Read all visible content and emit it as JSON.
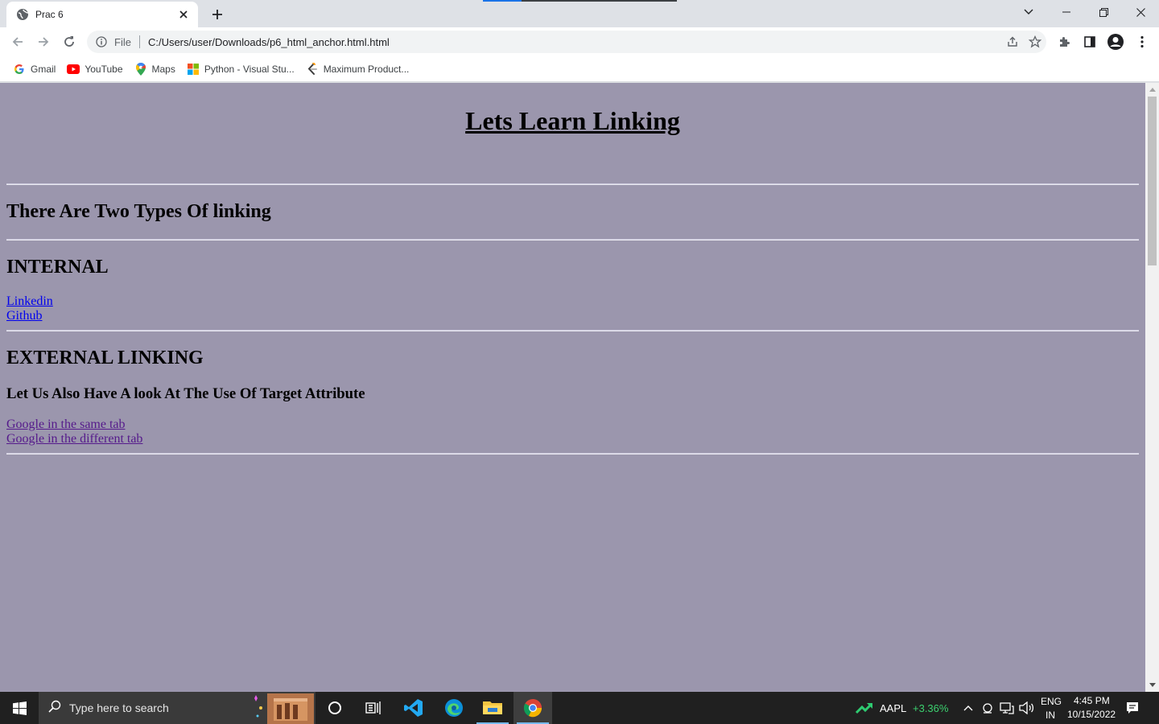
{
  "browser": {
    "tab_title": "Prac 6",
    "omnibox_scheme": "File",
    "url": "C:/Users/user/Downloads/p6_html_anchor.html.html",
    "bookmarks": [
      {
        "label": "Gmail",
        "icon": "gmail-icon"
      },
      {
        "label": "YouTube",
        "icon": "youtube-icon"
      },
      {
        "label": "Maps",
        "icon": "maps-icon"
      },
      {
        "label": "Python - Visual Stu...",
        "icon": "windows-grid-icon"
      },
      {
        "label": "Maximum Product...",
        "icon": "leetcode-icon"
      }
    ]
  },
  "page": {
    "title": "Lets Learn Linking",
    "types_heading": "There Are Two Types Of linking",
    "internal_heading": "INTERNAL",
    "internal_links": [
      "Linkedin",
      "Github"
    ],
    "external_heading": "EXTERNAL LINKING",
    "target_heading": "Let Us Also Have A look At The Use Of Target Attribute",
    "external_links": [
      "Google in the same tab",
      "Google in the different tab"
    ],
    "background_color": "#9b96ad"
  },
  "taskbar": {
    "search_placeholder": "Type here to search",
    "stock_symbol": "AAPL",
    "stock_change": "+3.36%",
    "language": "ENG",
    "region": "IN",
    "time": "4:45 PM",
    "date": "10/15/2022"
  }
}
